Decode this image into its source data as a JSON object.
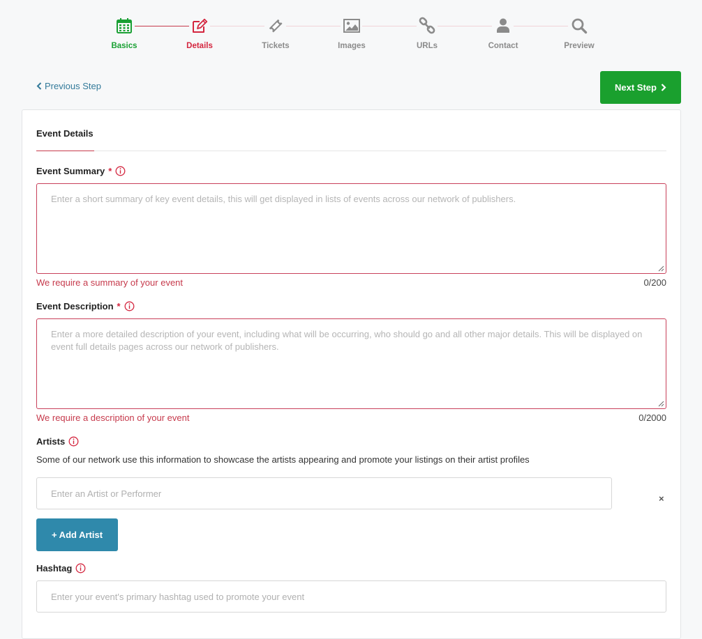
{
  "steps": [
    {
      "label": "Basics",
      "icon": "calendar-icon",
      "state": "done"
    },
    {
      "label": "Details",
      "icon": "edit-icon",
      "state": "current"
    },
    {
      "label": "Tickets",
      "icon": "ticket-icon",
      "state": "pending"
    },
    {
      "label": "Images",
      "icon": "image-icon",
      "state": "pending"
    },
    {
      "label": "URLs",
      "icon": "link-icon",
      "state": "pending"
    },
    {
      "label": "Contact",
      "icon": "user-icon",
      "state": "pending"
    },
    {
      "label": "Preview",
      "icon": "search-icon",
      "state": "pending"
    }
  ],
  "nav": {
    "previous_label": "Previous Step",
    "next_label": "Next Step"
  },
  "section": {
    "title": "Event Details"
  },
  "summary": {
    "label": "Event Summary",
    "required_mark": "*",
    "placeholder": "Enter a short summary of key event details, this will get displayed in lists of events across our network of publishers.",
    "error": "We require a summary of your event",
    "count": "0/200"
  },
  "description": {
    "label": "Event Description",
    "required_mark": "*",
    "placeholder": "Enter a more detailed description of your event, including what will be occurring, who should go and all other major details. This will be displayed on event full details pages across our network of publishers.",
    "error": "We require a description of your event",
    "count": "0/2000"
  },
  "artists": {
    "label": "Artists",
    "help": "Some of our network use this information to showcase the artists appearing and promote your listings on their artist profiles",
    "placeholder": "Enter an Artist or Performer",
    "remove_label": "×",
    "add_label": "+ Add Artist"
  },
  "hashtag": {
    "label": "Hashtag",
    "placeholder": "Enter your event's primary hashtag used to promote your event"
  },
  "colors": {
    "done": "#1aa034",
    "current": "#d4263f",
    "pending": "#8b8b8b",
    "next_button": "#1aa02e",
    "add_button": "#2f89ab"
  }
}
